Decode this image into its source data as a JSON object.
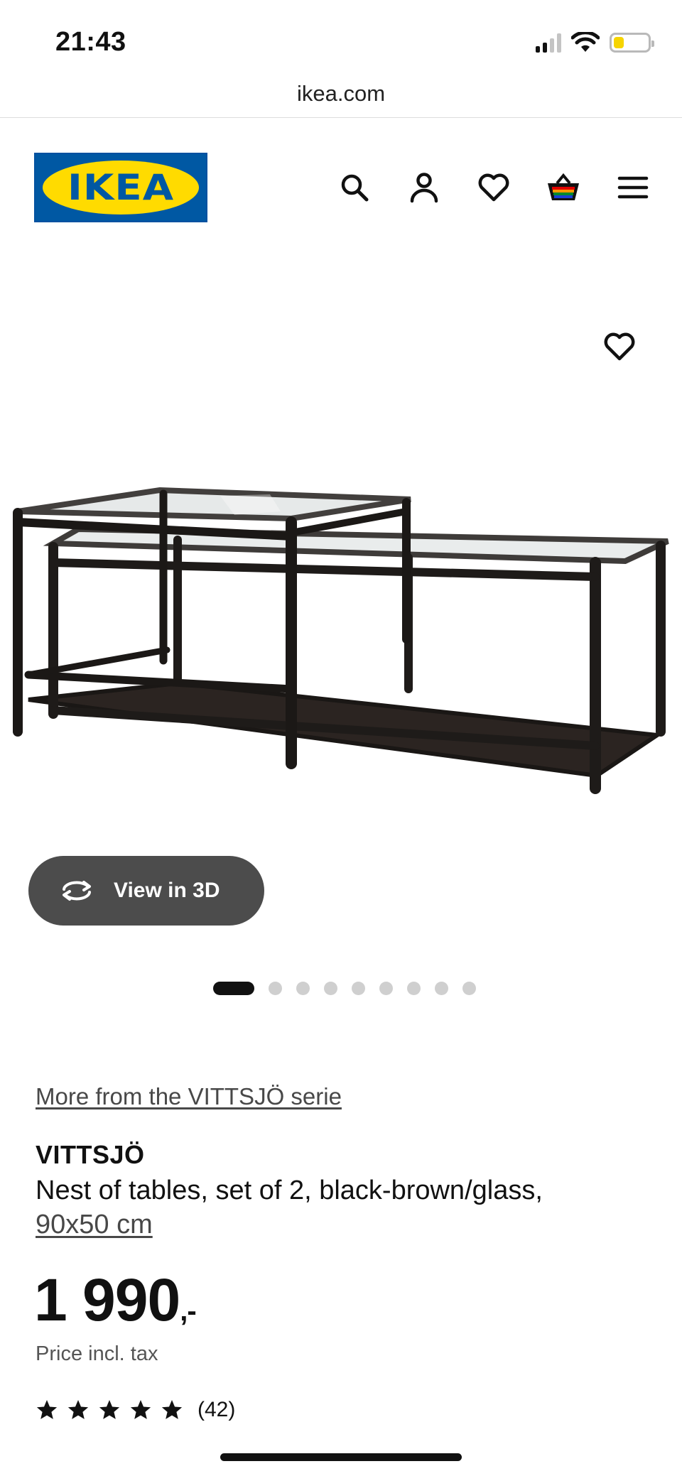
{
  "status_bar": {
    "time": "21:43",
    "signal_bars_filled": 2,
    "signal_bars_total": 4,
    "battery_level": 0.3,
    "battery_color": "#f6d400",
    "icons": [
      "signal-icon",
      "wifi-icon",
      "battery-icon"
    ]
  },
  "browser": {
    "url": "ikea.com"
  },
  "header": {
    "logo_text": "IKEA",
    "logo_colors": {
      "blue": "#0058a3",
      "yellow": "#ffdb00"
    },
    "icons": [
      "search-icon",
      "account-icon",
      "heart-icon",
      "basket-icon",
      "menu-icon"
    ]
  },
  "gallery": {
    "favorite_icon": "heart-icon",
    "view_3d_label": "View in 3D",
    "image_count": 9,
    "active_image_index": 0
  },
  "product": {
    "series_link": "More from the VITTSJÖ serie",
    "name": "VITTSJÖ",
    "description": "Nest of tables, set of 2, black-brown/glass,",
    "size": "90x50 cm",
    "price_main": "1 990",
    "price_suffix": ",-",
    "price_note": "Price incl. tax",
    "rating_stars": 5,
    "rating_count": "(42)"
  }
}
